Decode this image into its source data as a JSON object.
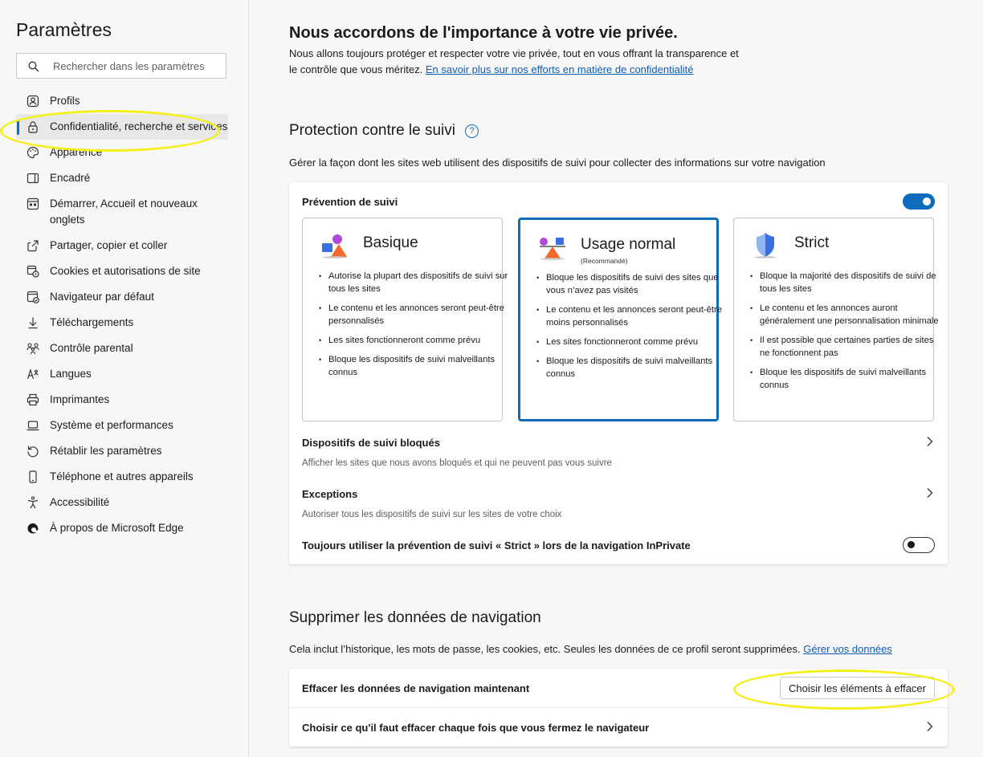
{
  "sidebar": {
    "title": "Paramètres",
    "search_placeholder": "Rechercher dans les paramètres",
    "items": [
      {
        "label": "Profils",
        "icon": "profile-icon"
      },
      {
        "label": "Confidentialité, recherche et services",
        "icon": "lock-icon",
        "active": true
      },
      {
        "label": "Apparence",
        "icon": "palette-icon"
      },
      {
        "label": "Encadré",
        "icon": "sidebar-panel-icon"
      },
      {
        "label": "Démarrer, Accueil et nouveaux onglets",
        "icon": "home-tabs-icon"
      },
      {
        "label": "Partager, copier et coller",
        "icon": "share-icon"
      },
      {
        "label": "Cookies et autorisations de site",
        "icon": "cookies-icon"
      },
      {
        "label": "Navigateur par défaut",
        "icon": "default-browser-icon"
      },
      {
        "label": "Téléchargements",
        "icon": "download-icon"
      },
      {
        "label": "Contrôle parental",
        "icon": "family-icon"
      },
      {
        "label": "Langues",
        "icon": "language-icon"
      },
      {
        "label": "Imprimantes",
        "icon": "printer-icon"
      },
      {
        "label": "Système et performances",
        "icon": "laptop-icon"
      },
      {
        "label": "Rétablir les paramètres",
        "icon": "reset-icon"
      },
      {
        "label": "Téléphone et autres appareils",
        "icon": "phone-icon"
      },
      {
        "label": "Accessibilité",
        "icon": "accessibility-icon"
      },
      {
        "label": "À propos de Microsoft Edge",
        "icon": "edge-logo-icon"
      }
    ]
  },
  "privacy": {
    "heading": "Nous accordons de l'importance à votre vie privée.",
    "text": "Nous allons toujours protéger et respecter votre vie privée, tout en vous offrant la transparence et le contrôle que vous méritez.",
    "link": "En savoir plus sur nos efforts en matière de confidentialité"
  },
  "tracking": {
    "heading": "Protection contre le suivi",
    "help_icon": "?",
    "description": "Gérer la façon dont les sites web utilisent des dispositifs de suivi pour collecter des informations sur votre navigation",
    "prevention_label": "Prévention de suivi",
    "prevention_enabled": true,
    "options": [
      {
        "title": "Basique",
        "icon": "basic-shapes-icon",
        "selected": false,
        "recommended": "",
        "bullets": [
          "Autorise la plupart des dispositifs de suivi sur tous les sites",
          "Le contenu et les annonces seront peut-être personnalisés",
          "Les sites fonctionneront comme prévu",
          "Bloque les dispositifs de suivi malveillants connus"
        ]
      },
      {
        "title": "Usage normal",
        "icon": "balanced-shapes-icon",
        "selected": true,
        "recommended": "(Recommandé)",
        "bullets": [
          "Bloque les dispositifs de suivi des sites que vous n’avez pas visités",
          "Le contenu et les annonces seront peut-être moins personnalisés",
          "Les sites fonctionneront comme prévu",
          "Bloque les dispositifs de suivi malveillants connus"
        ]
      },
      {
        "title": "Strict",
        "icon": "shield-icon",
        "selected": false,
        "recommended": "",
        "bullets": [
          "Bloque la majorité des dispositifs de suivi de tous les sites",
          "Le contenu et les annonces auront généralement une personnalisation minimale",
          "Il est possible que certaines parties de sites ne fonctionnent pas",
          "Bloque les dispositifs de suivi malveillants connus"
        ]
      }
    ],
    "blocked_title": "Dispositifs de suivi bloqués",
    "blocked_sub": "Afficher les sites que nous avons bloqués et qui ne peuvent pas vous suivre",
    "exceptions_title": "Exceptions",
    "exceptions_sub": "Autoriser tous les dispositifs de suivi sur les sites de votre choix",
    "inprivate_label": "Toujours utiliser la prévention de suivi « Strict » lors de la navigation InPrivate",
    "inprivate_enabled": false
  },
  "clear": {
    "heading": "Supprimer les données de navigation",
    "description": "Cela inclut l’historique, les mots de passe, les cookies, etc. Seules les données de ce profil seront supprimées.",
    "link": "Gérer vos données",
    "now_label": "Effacer les données de navigation maintenant",
    "now_button": "Choisir les éléments à effacer",
    "on_close_label": "Choisir ce qu'il faut effacer chaque fois que vous fermez le navigateur"
  },
  "colors": {
    "accent": "#0f6cbd",
    "highlight": "#f4f01e"
  }
}
